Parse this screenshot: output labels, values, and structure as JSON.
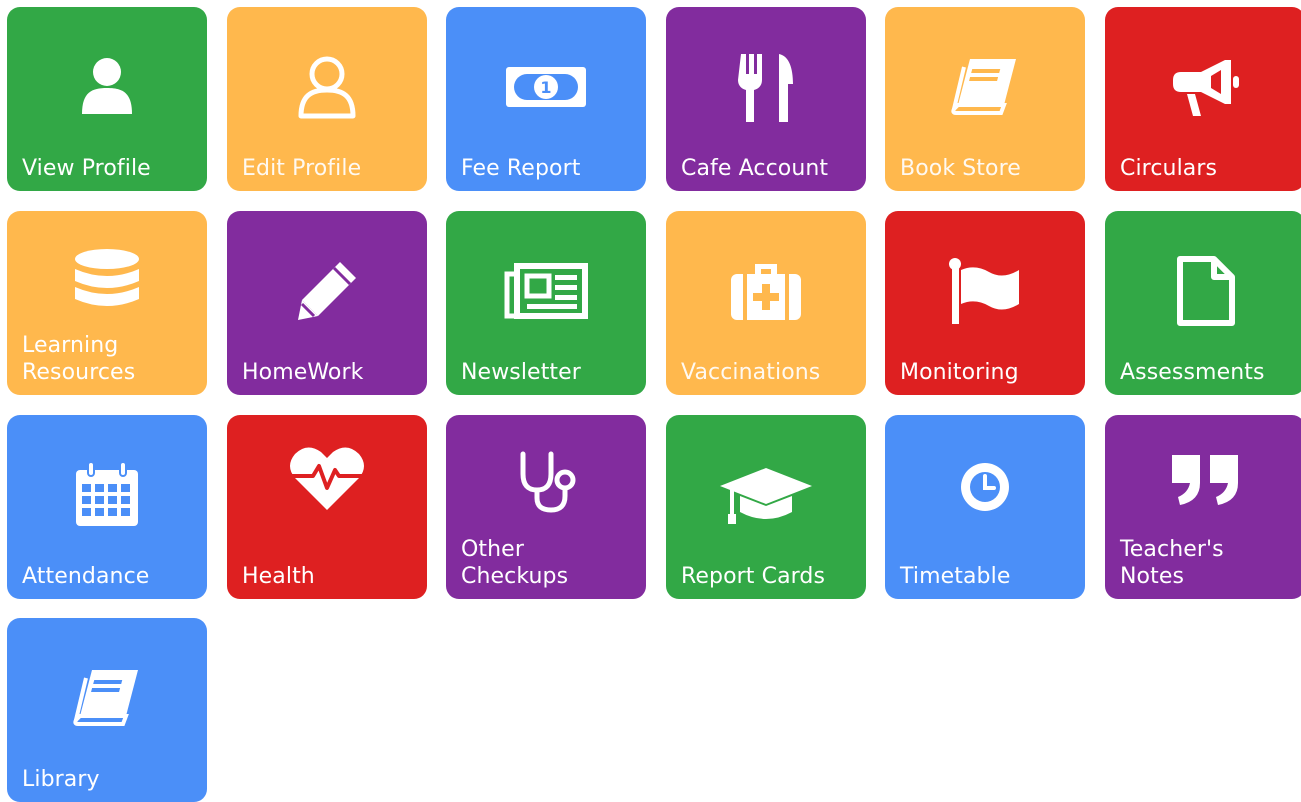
{
  "colors": {
    "green": "#32a846",
    "orange": "#ffb84d",
    "blue": "#4b8ff8",
    "purple": "#822c9e",
    "red": "#de2021"
  },
  "tiles": [
    {
      "label": "View Profile",
      "icon": "user-icon",
      "color": "green"
    },
    {
      "label": "Edit Profile",
      "icon": "user-outline-icon",
      "color": "orange"
    },
    {
      "label": "Fee Report",
      "icon": "banknote-icon",
      "color": "blue"
    },
    {
      "label": "Cafe Account",
      "icon": "fork-knife-icon",
      "color": "purple"
    },
    {
      "label": "Book Store",
      "icon": "book-icon",
      "color": "orange"
    },
    {
      "label": "Circulars",
      "icon": "megaphone-icon",
      "color": "red"
    },
    {
      "label": "Learning\nResources",
      "icon": "database-icon",
      "color": "orange"
    },
    {
      "label": "HomeWork",
      "icon": "pencil-icon",
      "color": "purple"
    },
    {
      "label": "Newsletter",
      "icon": "newspaper-icon",
      "color": "green"
    },
    {
      "label": "Vaccinations",
      "icon": "medkit-icon",
      "color": "orange"
    },
    {
      "label": "Monitoring",
      "icon": "flag-icon",
      "color": "red"
    },
    {
      "label": "Assessments",
      "icon": "document-icon",
      "color": "green"
    },
    {
      "label": "Attendance",
      "icon": "calendar-icon",
      "color": "blue"
    },
    {
      "label": "Health",
      "icon": "heartbeat-icon",
      "color": "red"
    },
    {
      "label": "Other\nCheckups",
      "icon": "stethoscope-icon",
      "color": "purple"
    },
    {
      "label": "Report Cards",
      "icon": "graduation-cap-icon",
      "color": "green"
    },
    {
      "label": "Timetable",
      "icon": "clock-icon",
      "color": "blue"
    },
    {
      "label": "Teacher's\nNotes",
      "icon": "quote-icon",
      "color": "purple"
    },
    {
      "label": "Library",
      "icon": "book-icon",
      "color": "blue"
    }
  ]
}
